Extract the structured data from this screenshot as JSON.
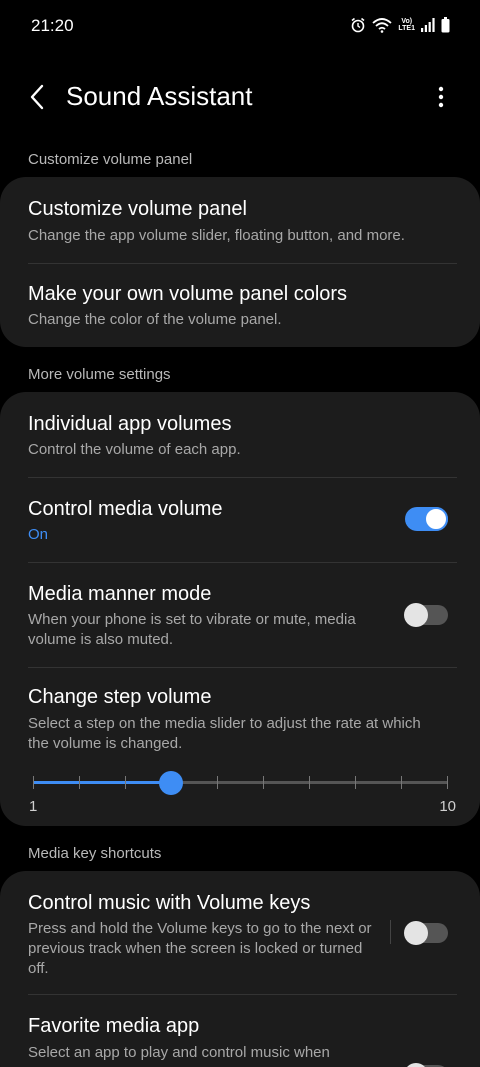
{
  "status_bar": {
    "time": "21:20",
    "icons": [
      "alarm-icon",
      "wifi-icon",
      "volte-icon",
      "signal-icon",
      "battery-icon"
    ],
    "volte_label_top": "Vo)",
    "volte_label_bottom": "LTE1"
  },
  "app_bar": {
    "title": "Sound Assistant"
  },
  "sections": {
    "customize": {
      "header": "Customize volume panel",
      "items": [
        {
          "title": "Customize volume panel",
          "subtitle": "Change the app volume slider, floating button, and more."
        },
        {
          "title": "Make your own volume panel colors",
          "subtitle": "Change the color of the volume panel."
        }
      ]
    },
    "more": {
      "header": "More volume settings",
      "individual": {
        "title": "Individual app volumes",
        "subtitle": "Control the volume of each app."
      },
      "control_media": {
        "title": "Control media volume",
        "subtitle": "On",
        "enabled": true
      },
      "manner": {
        "title": "Media manner mode",
        "subtitle": "When your phone is set to vibrate or mute, media volume is also muted.",
        "enabled": false
      },
      "step": {
        "title": "Change step volume",
        "subtitle": "Select a step on the media slider to adjust the rate at which the volume is changed.",
        "min": 1,
        "max": 10,
        "value": 4,
        "min_label": "1",
        "max_label": "10"
      }
    },
    "media_keys": {
      "header": "Media key shortcuts",
      "control_music": {
        "title": "Control music with Volume keys",
        "subtitle": "Press and hold the Volume keys to go to the next or previous track when the screen is locked or turned off.",
        "enabled": false
      },
      "favorite": {
        "title": "Favorite media app",
        "subtitle": "Select an app to play and control music when"
      }
    }
  },
  "colors": {
    "accent": "#3e8df4",
    "background": "#000000",
    "card": "#1c1c1c"
  }
}
